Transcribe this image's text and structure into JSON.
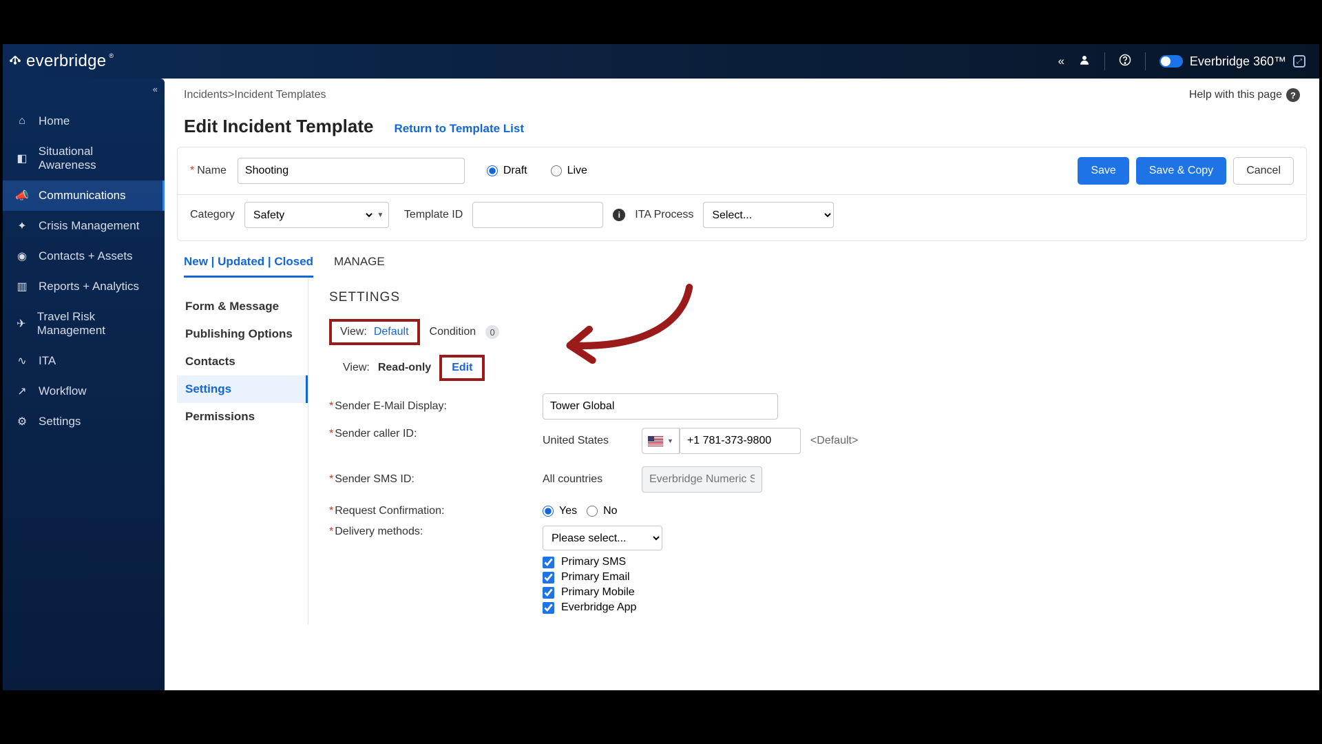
{
  "brand": "everbridge",
  "topbar": {
    "product": "Everbridge 360™"
  },
  "sidebar": {
    "items": [
      {
        "icon": "home-icon",
        "label": "Home"
      },
      {
        "icon": "sa-icon",
        "label": "Situational Awareness"
      },
      {
        "icon": "bullhorn-icon",
        "label": "Communications",
        "active": true
      },
      {
        "icon": "cm-icon",
        "label": "Crisis Management"
      },
      {
        "icon": "contacts-icon",
        "label": "Contacts + Assets"
      },
      {
        "icon": "chart-icon",
        "label": "Reports + Analytics"
      },
      {
        "icon": "plane-icon",
        "label": "Travel Risk Management"
      },
      {
        "icon": "ita-icon",
        "label": "ITA"
      },
      {
        "icon": "wf-icon",
        "label": "Workflow"
      },
      {
        "icon": "gear-icon",
        "label": "Settings"
      }
    ]
  },
  "breadcrumb": {
    "root": "Incidents",
    "sep": " > ",
    "current": "Incident Templates"
  },
  "help_page": "Help with this page",
  "page": {
    "title": "Edit Incident Template",
    "return": "Return to Template List"
  },
  "form": {
    "name_label": "Name",
    "name_value": "Shooting",
    "status_draft": "Draft",
    "status_live": "Live",
    "category_label": "Category",
    "category_value": "Safety",
    "template_id_label": "Template ID",
    "template_id_value": "",
    "ita_label": "ITA Process",
    "ita_placeholder": "Select..."
  },
  "buttons": {
    "save": "Save",
    "save_copy": "Save & Copy",
    "cancel": "Cancel"
  },
  "tabs": {
    "main": "New | Updated | Closed",
    "manage": "MANAGE"
  },
  "subnav": [
    "Form & Message",
    "Publishing Options",
    "Contacts",
    "Settings",
    "Permissions"
  ],
  "subnav_active": 3,
  "settings": {
    "heading": "SETTINGS",
    "view_label": "View:",
    "view_value": "Default",
    "condition_label": "Condition",
    "condition_count": "0",
    "view_mode_label": "View:",
    "view_mode_value": "Read-only",
    "edit": "Edit",
    "sender_email_display": "Sender E-Mail Display:",
    "sender_email_value": "Tower Global",
    "sender_caller_id": "Sender caller ID:",
    "caller_country": "United States",
    "caller_phone": "+1 781-373-9800",
    "caller_default": "<Default>",
    "sender_sms_id": "Sender SMS ID:",
    "sms_country": "All countries",
    "sms_placeholder": "Everbridge Numeric SMS ID",
    "request_confirmation": "Request Confirmation:",
    "yes": "Yes",
    "no": "No",
    "delivery_label": "Delivery methods:",
    "delivery_placeholder": "Please select...",
    "methods": [
      "Primary SMS",
      "Primary Email",
      "Primary Mobile",
      "Everbridge App"
    ]
  }
}
